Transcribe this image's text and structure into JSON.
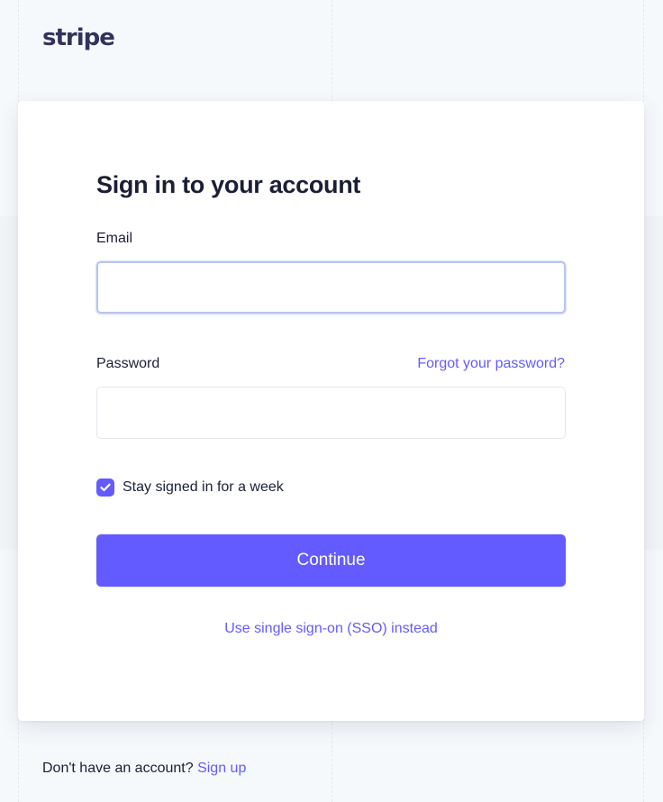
{
  "brand": {
    "logo_text": "stripe"
  },
  "form": {
    "title": "Sign in to your account",
    "email_label": "Email",
    "email_value": "",
    "password_label": "Password",
    "password_value": "",
    "forgot_link": "Forgot your password?",
    "remember_label": "Stay signed in for a week",
    "remember_checked": true,
    "continue_label": "Continue",
    "sso_link": "Use single sign-on (SSO) instead"
  },
  "footer": {
    "prompt": "Don't have an account?",
    "signup_link": "Sign up"
  },
  "colors": {
    "accent": "#635bff",
    "text": "#1a1f36",
    "background": "#f6f9fc",
    "card": "#ffffff"
  },
  "icons": {
    "checkbox": "checkmark-icon"
  }
}
